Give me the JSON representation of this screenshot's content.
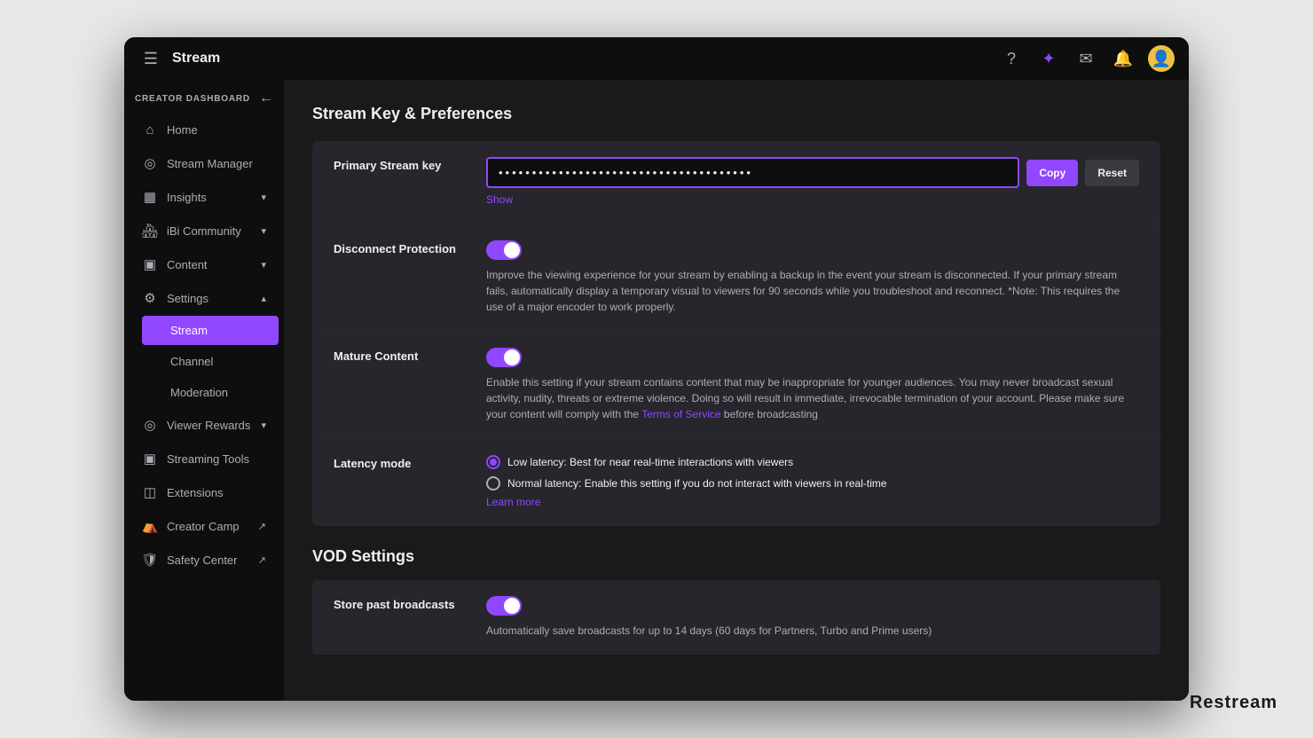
{
  "window": {
    "title": "Stream",
    "restream": "Restream"
  },
  "titlebar": {
    "title": "Stream",
    "icons": {
      "help": "?",
      "magic": "✦",
      "mail": "✉",
      "bell": "🔔"
    }
  },
  "sidebar": {
    "header_label": "Creator Dashboard",
    "items": [
      {
        "id": "home",
        "label": "Home",
        "icon": "⌂",
        "has_expand": false
      },
      {
        "id": "stream-manager",
        "label": "Stream Manager",
        "icon": "◎",
        "has_expand": false
      },
      {
        "id": "insights",
        "label": "Insights",
        "icon": "▦",
        "has_expand": true
      },
      {
        "id": "community",
        "label": "iBi Community",
        "icon": "🏘",
        "has_expand": true
      },
      {
        "id": "content",
        "label": "Content",
        "icon": "▣",
        "has_expand": true
      },
      {
        "id": "settings",
        "label": "Settings",
        "icon": "⚙",
        "has_expand": true,
        "expanded": true
      },
      {
        "id": "stream",
        "label": "Stream",
        "is_sub": true,
        "active": true
      },
      {
        "id": "channel",
        "label": "Channel",
        "is_sub": true
      },
      {
        "id": "moderation",
        "label": "Moderation",
        "is_sub": true
      },
      {
        "id": "viewer-rewards",
        "label": "Viewer Rewards",
        "icon": "◎",
        "has_expand": true
      },
      {
        "id": "streaming-tools",
        "label": "Streaming Tools",
        "icon": "▣",
        "has_expand": false
      },
      {
        "id": "extensions",
        "label": "Extensions",
        "icon": "◫",
        "has_expand": false
      },
      {
        "id": "creator-camp",
        "label": "Creator Camp",
        "icon": "⛺",
        "has_expand": false,
        "has_ext": true
      },
      {
        "id": "safety-center",
        "label": "Safety Center",
        "icon": "🛡",
        "has_expand": false,
        "has_ext": true
      }
    ]
  },
  "main": {
    "stream_key_section_title": "Stream Key & Preferences",
    "stream_key": {
      "label": "Primary Stream key",
      "placeholder": "••••••••••••••••••••••••••••••••••••••",
      "copy_btn": "Copy",
      "reset_btn": "Reset",
      "show_link": "Show"
    },
    "disconnect_protection": {
      "label": "Disconnect Protection",
      "toggle_on": true,
      "description": "Improve the viewing experience for your stream by enabling a backup in the event your stream is disconnected. If your primary stream fails, automatically display a temporary visual to viewers for 90 seconds while you troubleshoot and reconnect. *Note: This requires the use of a major encoder to work properly."
    },
    "mature_content": {
      "label": "Mature Content",
      "toggle_on": true,
      "description_part1": "Enable this setting if your stream contains content that may be inappropriate for younger audiences. You may never broadcast sexual activity, nudity, threats or extreme violence. Doing so will result in immediate, irrevocable termination of your account. Please make sure your content will comply with the ",
      "terms_link": "Terms of Service",
      "description_part2": " before broadcasting"
    },
    "latency_mode": {
      "label": "Latency mode",
      "options": [
        {
          "id": "low",
          "label": "Low latency: Best for near real-time interactions with viewers",
          "selected": true
        },
        {
          "id": "normal",
          "label": "Normal latency: Enable this setting if you do not interact with viewers in real-time",
          "selected": false
        }
      ],
      "learn_more": "Learn more"
    },
    "vod_section_title": "VOD Settings",
    "store_broadcasts": {
      "label": "Store past broadcasts",
      "toggle_on": true,
      "description": "Automatically save broadcasts for up to 14 days (60 days for Partners, Turbo and Prime users)"
    }
  }
}
